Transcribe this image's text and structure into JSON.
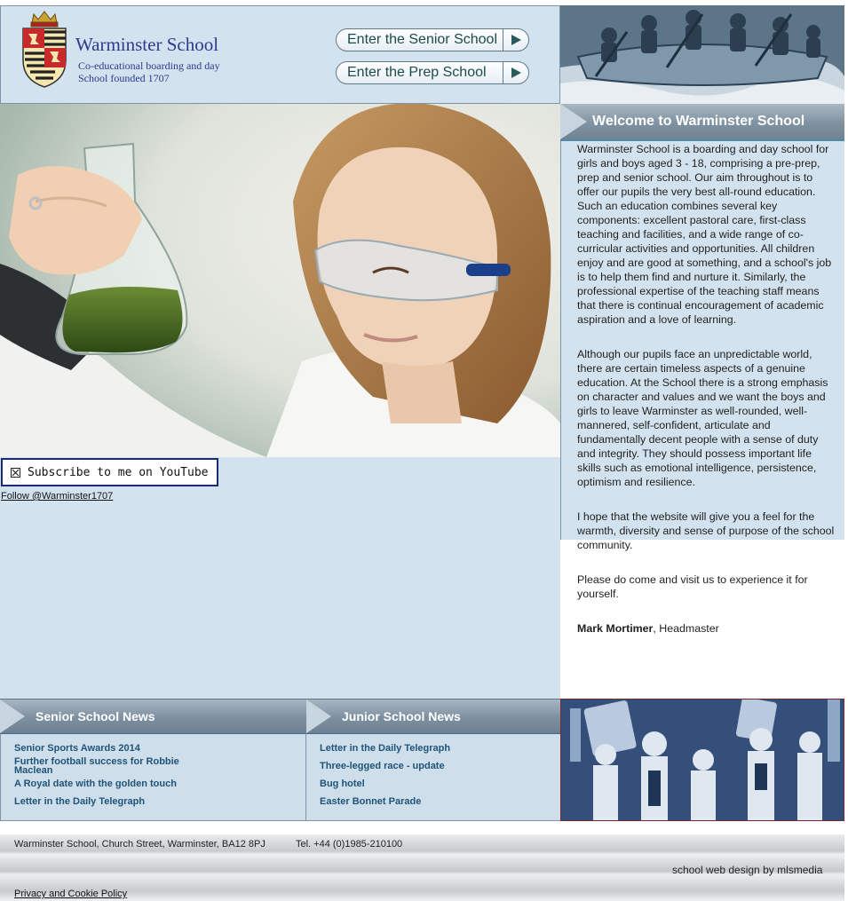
{
  "header": {
    "school_name": "Warminster School",
    "tagline_1": "Co-educational boarding and day",
    "tagline_2": "School founded 1707",
    "senior_button": "Enter the Senior School",
    "prep_button": "Enter the Prep School"
  },
  "welcome": {
    "title": "Welcome to Warminster School",
    "paragraphs": [
      "Warminster School is a boarding and day school for girls and boys aged 3 - 18, comprising a pre-prep, prep and senior school. Our aim throughout is to offer our pupils the very best all-round education. Such an education combines several key components: excellent pastoral care, first-class teaching and facilities, and a wide range of co-curricular activities and opportunities. All children enjoy and are good at something, and a school's job is to help them find and nurture it. Similarly, the professional expertise of the teaching staff means that there is continual encouragement of academic aspiration and a love of learning.",
      "Although our pupils face an unpredictable world, there are certain timeless aspects of a genuine education. At the School there is a strong emphasis on character and values and we want the boys and girls to leave Warminster as well-rounded, well-mannered, self-confident, articulate and fundamentally decent people with a sense of duty and integrity. They should possess important life skills such as emotional intelligence, persistence, optimism and resilience.",
      "I hope that the website will give you a feel for the warmth, diversity and sense of purpose of the school community.",
      "Please do come and visit us to experience it for yourself."
    ],
    "signature_name": "Mark Mortimer",
    "signature_role": ", Headmaster"
  },
  "social": {
    "youtube_label": "Subscribe to me on YouTube",
    "follow_label": "Follow @Warminster1707"
  },
  "senior_news": {
    "title": "Senior School News",
    "items": [
      "Senior Sports Awards 2014",
      "Further football success for Robbie Maclean",
      "A Royal date with the golden touch",
      "Letter in the Daily Telegraph"
    ]
  },
  "junior_news": {
    "title": "Junior School News",
    "items": [
      "Letter in the Daily Telegraph",
      "Three-legged race - update",
      "Bug hotel",
      "Easter Bonnet Parade"
    ]
  },
  "footer": {
    "address": "Warminster School, Church Street, Warminster, BA12 8PJ",
    "tel": "Tel. +44 (0)1985-210100",
    "credit": "school web design by mlsmedia",
    "privacy": "Privacy and Cookie Policy"
  },
  "colors": {
    "panel_blue": "#d2e3ef",
    "brand_navy": "#2c3a8e",
    "news_link": "#1f5478"
  }
}
